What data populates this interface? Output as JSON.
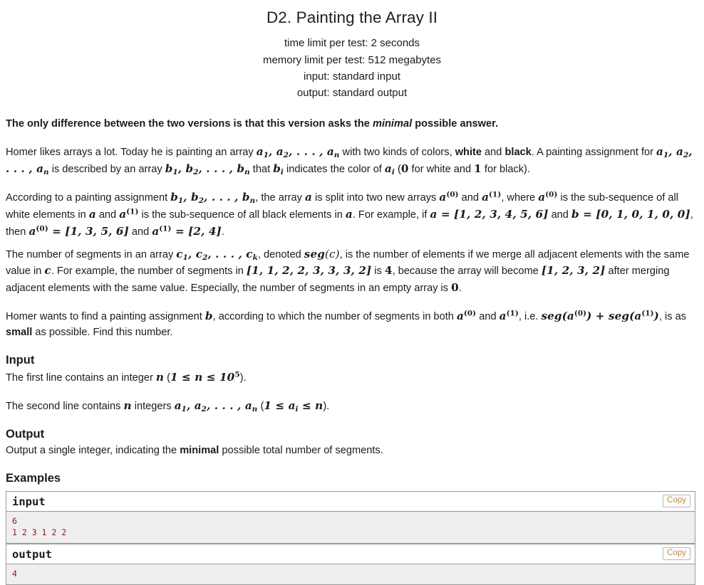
{
  "header": {
    "title": "D2. Painting the Array II",
    "limits": [
      "time limit per test: 2 seconds",
      "memory limit per test: 512 megabytes",
      "input: standard input",
      "output: standard output"
    ]
  },
  "statement": {
    "difference_note_pre": "The only difference between the two versions is that this version asks the ",
    "difference_note_em": "minimal",
    "difference_note_post": " possible answer.",
    "p1_a": "Homer likes arrays a lot. Today he is painting an array ",
    "p1_math1_a": "a",
    "p1_math1_a1": "1",
    "p1_math1_b": "a",
    "p1_math1_b2": "2",
    "p1_math1_dots": ", . . . ,",
    "p1_math1_c": "a",
    "p1_math1_cn": "n",
    "p1_b": " with two kinds of colors, ",
    "p1_white": "white",
    "p1_c": " and ",
    "p1_black": "black",
    "p1_d": ". A painting assignment for ",
    "p1_e": " is described by an array ",
    "p1_f": " that ",
    "p1_g": " indicates the color of ",
    "p1_h": " (",
    "p1_zero": "0",
    "p1_i": " for white and ",
    "p1_one": "1",
    "p1_j": " for black).",
    "p2_a": "According to a painting assignment ",
    "p2_b": ", the array ",
    "p2_c": " is split into two new arrays ",
    "p2_d": " and ",
    "p2_e": ", where ",
    "p2_f": " is the sub-sequence of all white elements in ",
    "p2_g": " and ",
    "p2_h": " is the sub-sequence of all black elements in ",
    "p2_i": ". For example, if ",
    "p2_arr_a": "a = [1, 2, 3, 4, 5, 6]",
    "p2_j": " and ",
    "p2_arr_b": "b = [0, 1, 0, 1, 0, 0]",
    "p2_k": ", then ",
    "p2_res_a": "= [1, 3, 5, 6]",
    "p2_l": " and ",
    "p2_res_b": "= [2, 4]",
    "p2_m": ".",
    "p3_a": "The number of segments in an array ",
    "p3_c1": "c",
    "p3_b": ", denoted ",
    "p3_seg": "seg",
    "p3_segc": "(c)",
    "p3_d": ", is the number of elements if we merge all adjacent elements with the same value in ",
    "p3_e": "c",
    "p3_f": ". For example, the number of segments in ",
    "p3_arr1": "[1, 1, 2, 2, 3, 3, 3, 2]",
    "p3_g": " is ",
    "p3_four": "4",
    "p3_h": ", because the array will become ",
    "p3_arr2": "[1, 2, 3, 2]",
    "p3_i": " after merging adjacent elements with the same value. Especially, the number of segments in an empty array is ",
    "p3_zero": "0",
    "p3_j": ".",
    "p4_a": "Homer wants to find a painting assignment ",
    "p4_b": "b",
    "p4_c": ", according to which the number of segments in both ",
    "p4_d": " and ",
    "p4_e": ", i.e. ",
    "p4_f": ", is as ",
    "p4_small": "small",
    "p4_g": " as possible. Find this number."
  },
  "input_section": {
    "heading": "Input",
    "line1_a": "The first line contains an integer ",
    "line1_n": "n",
    "line1_b": " (",
    "line1_constraint": "1 ≤ n ≤ 10",
    "line1_sup": "5",
    "line1_c": ").",
    "line2_a": "The second line contains ",
    "line2_n": "n",
    "line2_b": " integers ",
    "line2_c": " (",
    "line2_constraint": "1 ≤ a",
    "line2_sub": "i",
    "line2_constraint2": " ≤ n",
    "line2_d": ")."
  },
  "output_section": {
    "heading": "Output",
    "line_a": "Output a single integer, indicating the ",
    "line_bold": "minimal",
    "line_b": " possible total number of segments."
  },
  "examples_section": {
    "heading": "Examples",
    "copy_label": "Copy",
    "blocks": [
      {
        "title": "input",
        "content": "6\n1 2 3 1 2 2"
      },
      {
        "title": "output",
        "content": "4"
      }
    ]
  },
  "colors": {
    "sample_text": "#8b1a1a",
    "copy_text": "#c08a4a",
    "border": "#9a9a9a",
    "sample_bg": "#efefef"
  }
}
